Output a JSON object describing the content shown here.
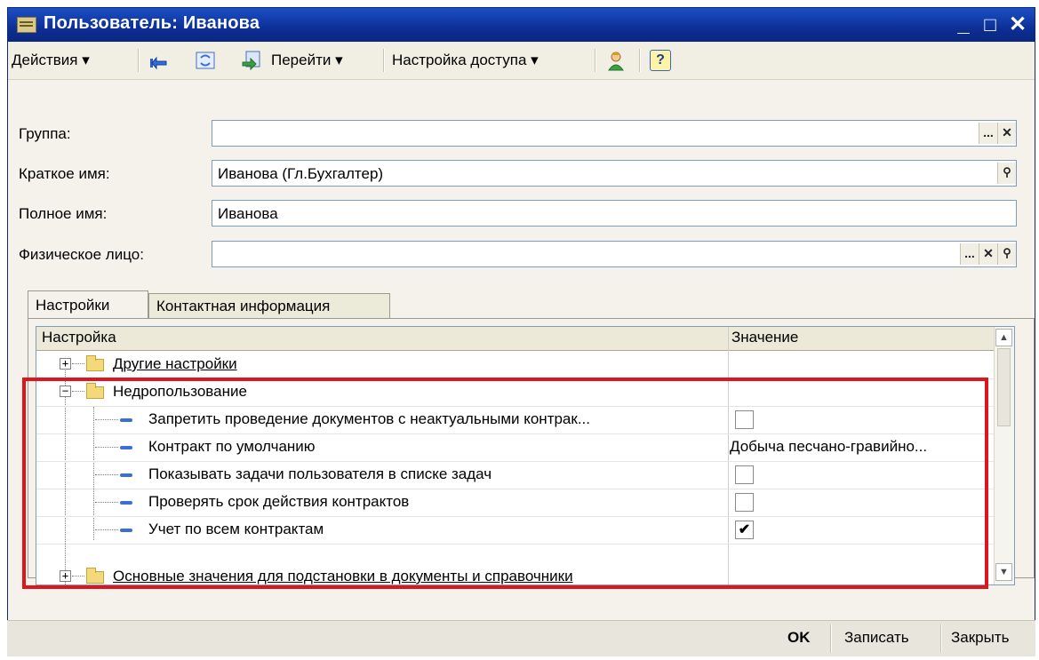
{
  "window": {
    "title": "Пользователь: Иванова",
    "controls": {
      "minimize": "_",
      "maximize": "□",
      "close": "✕"
    }
  },
  "toolbar": {
    "actions": "Действия ▾",
    "goto": "Перейти ▾",
    "access": "Настройка доступа ▾",
    "help": "?"
  },
  "form": {
    "group_label": "Группа:",
    "group_value": "",
    "short_name_label": "Краткое имя:",
    "short_name_value": "Иванова (Гл.Бухгалтер)",
    "full_name_label": "Полное имя:",
    "full_name_value": "Иванова",
    "person_label": "Физическое лицо:",
    "person_value": "",
    "btn_select": "...",
    "btn_clear": "✕",
    "btn_search": "🔍"
  },
  "tabs": [
    {
      "label": "Настройки",
      "active": true
    },
    {
      "label": "Контактная информация",
      "active": false
    }
  ],
  "table": {
    "headers": {
      "setting": "Настройка",
      "value": "Значение"
    },
    "rows": [
      {
        "label": "Другие настройки",
        "expander": "+",
        "value": ""
      },
      {
        "label": "Недропользование",
        "expander": "−",
        "value": ""
      },
      {
        "label": "Запретить проведение документов с неактуальными контрак...",
        "value": "",
        "checked": false
      },
      {
        "label": "Контракт по умолчанию",
        "value": "Добыча песчано-гравийно..."
      },
      {
        "label": "Показывать задачи пользователя в списке задач",
        "value": "",
        "checked": false
      },
      {
        "label": "Проверять срок действия контрактов",
        "value": "",
        "checked": false
      },
      {
        "label": "Учет по всем контрактам",
        "value": "",
        "checked": true,
        "check_mark": "✔"
      },
      {
        "label": "Основные значения для подстановки в документы и справочники",
        "expander": "+",
        "value": ""
      }
    ]
  },
  "bottom": {
    "ok": "OK",
    "save": "Записать",
    "close": "Закрыть"
  },
  "colors": {
    "title_bar": "#0c2f96",
    "highlight": "#e0141c",
    "window_bg": "#f4f2ea"
  }
}
